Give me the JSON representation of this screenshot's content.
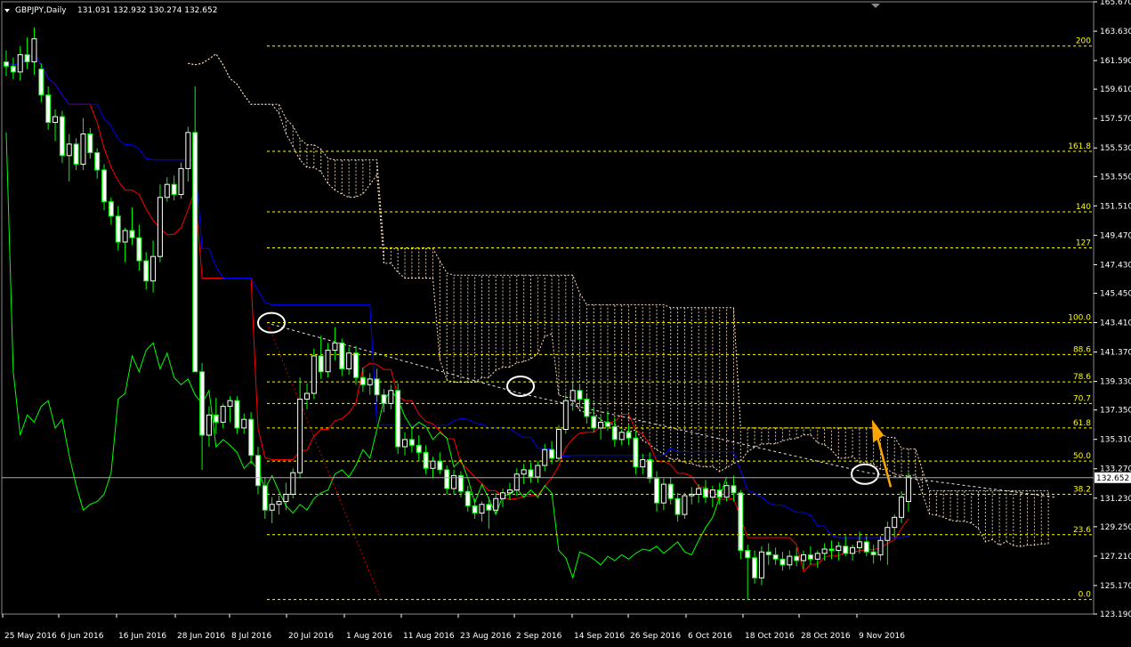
{
  "header": {
    "title": "GBPJPY,Daily",
    "ohlc": "131.031 132.932 130.274 132.652"
  },
  "colors": {
    "background": "#000000",
    "bull_candle": "#ffffff",
    "bear_candle": "#ffffff",
    "wick": "#00ff00",
    "tenkan": "#ff0000",
    "kijun": "#0000ff",
    "chikou": "#00ff00",
    "fib": "#ffff00",
    "kumo": "#ffe0c0",
    "arrow": "#ffa500",
    "price_line": "#aaaaaa"
  },
  "chart_data": {
    "type": "candlestick",
    "symbol": "GBPJPY",
    "timeframe": "Daily",
    "ylim": [
      123.19,
      165.67
    ],
    "y_ticks": [
      "165.670",
      "163.630",
      "161.590",
      "159.610",
      "157.570",
      "155.530",
      "153.550",
      "151.510",
      "149.470",
      "147.430",
      "145.450",
      "143.410",
      "141.370",
      "139.330",
      "137.350",
      "135.310",
      "133.270",
      "131.230",
      "129.250",
      "127.210",
      "125.170",
      "123.190"
    ],
    "x_ticks": [
      "25 May 2016",
      "6 Jun 2016",
      "16 Jun 2016",
      "28 Jun 2016",
      "8 Jul 2016",
      "20 Jul 2016",
      "1 Aug 2016",
      "11 Aug 2016",
      "23 Aug 2016",
      "2 Sep 2016",
      "14 Sep 2016",
      "26 Sep 2016",
      "6 Oct 2016",
      "18 Oct 2016",
      "28 Oct 2016",
      "9 Nov 2016"
    ],
    "current_price": "132.652",
    "fibonacci": {
      "high": 143.41,
      "low": 124.2,
      "levels": [
        {
          "label": "200",
          "value": 162.6
        },
        {
          "label": "161.8",
          "value": 155.3
        },
        {
          "label": "140",
          "value": 151.1
        },
        {
          "label": "127",
          "value": 148.6
        },
        {
          "label": "100.0",
          "value": 143.41
        },
        {
          "label": "88.6",
          "value": 141.2
        },
        {
          "label": "78.6",
          "value": 139.3
        },
        {
          "label": "70.7",
          "value": 137.8
        },
        {
          "label": "61.8",
          "value": 136.1
        },
        {
          "label": "50.0",
          "value": 133.8
        },
        {
          "label": "38.2",
          "value": 131.5
        },
        {
          "label": "23.6",
          "value": 128.7
        },
        {
          "label": "0.0",
          "value": 124.2
        }
      ]
    },
    "candles": [
      [
        161.5,
        162.3,
        160.5,
        161.2
      ],
      [
        161.2,
        161.8,
        160.3,
        160.8
      ],
      [
        160.8,
        162.6,
        160.2,
        162.0
      ],
      [
        162.0,
        163.2,
        161.0,
        161.5
      ],
      [
        161.5,
        163.9,
        160.6,
        163.1
      ],
      [
        161.0,
        161.4,
        158.7,
        159.2
      ],
      [
        159.2,
        159.8,
        156.8,
        157.3
      ],
      [
        157.3,
        158.2,
        156.0,
        157.7
      ],
      [
        157.7,
        158.1,
        154.5,
        155.0
      ],
      [
        155.0,
        156.5,
        153.2,
        155.8
      ],
      [
        155.8,
        156.2,
        154.0,
        154.4
      ],
      [
        154.4,
        157.6,
        154.0,
        156.5
      ],
      [
        156.5,
        156.9,
        154.8,
        155.2
      ],
      [
        155.2,
        155.5,
        153.4,
        154.0
      ],
      [
        154.0,
        154.4,
        151.2,
        151.8
      ],
      [
        151.8,
        152.1,
        150.2,
        150.8
      ],
      [
        150.8,
        151.5,
        148.4,
        149.0
      ],
      [
        149.0,
        150.0,
        147.6,
        149.8
      ],
      [
        149.8,
        151.4,
        148.8,
        149.3
      ],
      [
        149.3,
        150.2,
        147.0,
        147.7
      ],
      [
        147.7,
        148.3,
        145.7,
        146.3
      ],
      [
        146.3,
        149.1,
        145.5,
        148.0
      ],
      [
        148.0,
        153.0,
        147.6,
        152.1
      ],
      [
        152.1,
        153.5,
        151.8,
        153.0
      ],
      [
        153.0,
        153.6,
        151.9,
        152.3
      ],
      [
        152.3,
        154.5,
        152.0,
        154.1
      ],
      [
        154.1,
        157.0,
        153.2,
        156.6
      ],
      [
        156.6,
        159.8,
        154.2,
        140.0
      ],
      [
        140.0,
        140.6,
        133.2,
        135.6
      ],
      [
        135.6,
        137.6,
        134.8,
        137.0
      ],
      [
        137.0,
        138.2,
        135.7,
        136.5
      ],
      [
        136.5,
        137.8,
        136.1,
        137.6
      ],
      [
        137.6,
        138.3,
        136.5,
        138.0
      ],
      [
        138.0,
        138.3,
        135.7,
        136.1
      ],
      [
        136.1,
        137.1,
        135.7,
        136.7
      ],
      [
        136.7,
        137.2,
        133.6,
        134.2
      ],
      [
        134.2,
        134.8,
        131.5,
        132.1
      ],
      [
        132.1,
        132.7,
        129.8,
        130.4
      ],
      [
        130.4,
        131.3,
        129.5,
        130.8
      ],
      [
        130.8,
        131.4,
        130.1,
        131.0
      ],
      [
        131.0,
        132.3,
        130.4,
        131.5
      ],
      [
        131.5,
        133.3,
        131.2,
        133.0
      ],
      [
        133.0,
        139.6,
        132.6,
        138.1
      ],
      [
        138.1,
        139.2,
        137.4,
        138.5
      ],
      [
        138.5,
        141.6,
        138.1,
        141.1
      ],
      [
        141.1,
        142.5,
        139.5,
        140.0
      ],
      [
        140.0,
        142.0,
        139.6,
        141.5
      ],
      [
        141.5,
        143.1,
        140.8,
        142.0
      ],
      [
        142.0,
        142.3,
        139.7,
        140.2
      ],
      [
        140.2,
        141.7,
        139.8,
        141.3
      ],
      [
        141.3,
        141.8,
        139.1,
        139.6
      ],
      [
        139.6,
        140.3,
        138.6,
        139.1
      ],
      [
        139.1,
        139.9,
        138.4,
        139.5
      ],
      [
        139.5,
        140.2,
        137.9,
        138.4
      ],
      [
        138.4,
        138.8,
        137.2,
        137.8
      ],
      [
        137.8,
        139.1,
        137.4,
        138.7
      ],
      [
        138.7,
        139.2,
        134.3,
        134.8
      ],
      [
        134.8,
        135.8,
        134.2,
        135.3
      ],
      [
        135.3,
        136.1,
        134.4,
        134.9
      ],
      [
        134.9,
        135.6,
        133.8,
        134.4
      ],
      [
        134.4,
        134.9,
        132.9,
        133.3
      ],
      [
        133.3,
        134.1,
        132.6,
        133.8
      ],
      [
        133.8,
        134.4,
        132.9,
        133.2
      ],
      [
        133.2,
        133.5,
        131.5,
        131.9
      ],
      [
        131.9,
        133.2,
        131.5,
        132.8
      ],
      [
        132.8,
        133.1,
        131.3,
        131.7
      ],
      [
        131.7,
        132.1,
        130.3,
        130.7
      ],
      [
        130.7,
        131.2,
        129.8,
        130.2
      ],
      [
        130.2,
        131.0,
        129.6,
        130.8
      ],
      [
        130.8,
        131.3,
        129.1,
        130.4
      ],
      [
        130.4,
        131.6,
        130.1,
        131.2
      ],
      [
        131.2,
        131.9,
        130.6,
        131.6
      ],
      [
        131.6,
        132.3,
        131.1,
        131.8
      ],
      [
        131.8,
        133.3,
        131.4,
        132.9
      ],
      [
        132.9,
        133.6,
        132.2,
        133.2
      ],
      [
        133.2,
        133.7,
        132.3,
        132.7
      ],
      [
        132.7,
        133.8,
        132.3,
        133.5
      ],
      [
        133.5,
        135.0,
        133.1,
        134.6
      ],
      [
        134.6,
        135.2,
        133.6,
        134.0
      ],
      [
        134.0,
        136.3,
        133.8,
        136.0
      ],
      [
        136.0,
        138.4,
        135.7,
        138.0
      ],
      [
        138.0,
        139.3,
        137.3,
        138.7
      ],
      [
        138.7,
        139.0,
        137.6,
        138.1
      ],
      [
        138.1,
        138.4,
        136.4,
        136.9
      ],
      [
        136.9,
        137.6,
        135.8,
        136.1
      ],
      [
        136.1,
        136.9,
        135.3,
        136.5
      ],
      [
        136.5,
        137.3,
        135.9,
        136.2
      ],
      [
        136.2,
        136.8,
        134.8,
        135.3
      ],
      [
        135.3,
        136.0,
        134.9,
        135.8
      ],
      [
        135.8,
        136.3,
        134.9,
        135.4
      ],
      [
        135.4,
        135.9,
        132.9,
        133.4
      ],
      [
        133.4,
        134.3,
        132.9,
        133.9
      ],
      [
        133.9,
        134.4,
        132.3,
        132.6
      ],
      [
        132.6,
        133.1,
        130.3,
        130.9
      ],
      [
        130.9,
        132.6,
        130.4,
        132.2
      ],
      [
        132.2,
        132.7,
        130.8,
        131.2
      ],
      [
        131.2,
        131.6,
        129.6,
        130.1
      ],
      [
        130.1,
        131.6,
        129.8,
        131.4
      ],
      [
        131.4,
        132.0,
        130.8,
        131.5
      ],
      [
        131.5,
        132.2,
        130.9,
        131.9
      ],
      [
        131.9,
        132.5,
        130.9,
        131.3
      ],
      [
        131.3,
        132.1,
        130.6,
        131.8
      ],
      [
        131.8,
        132.3,
        130.8,
        131.3
      ],
      [
        131.3,
        132.4,
        131.0,
        132.1
      ],
      [
        132.1,
        132.8,
        131.0,
        131.6
      ],
      [
        131.6,
        131.8,
        127.0,
        127.6
      ],
      [
        127.6,
        128.0,
        124.2,
        127.1
      ],
      [
        127.1,
        127.6,
        125.3,
        125.7
      ],
      [
        125.7,
        127.9,
        125.2,
        127.5
      ],
      [
        127.5,
        128.1,
        126.6,
        127.3
      ],
      [
        127.3,
        127.8,
        126.6,
        127.0
      ],
      [
        127.0,
        127.5,
        126.2,
        126.6
      ],
      [
        126.6,
        127.6,
        126.3,
        127.2
      ],
      [
        127.2,
        127.8,
        126.5,
        126.9
      ],
      [
        126.9,
        127.6,
        126.3,
        127.3
      ],
      [
        127.3,
        127.9,
        126.6,
        127.0
      ],
      [
        127.0,
        127.6,
        126.4,
        127.4
      ],
      [
        127.4,
        128.1,
        126.9,
        127.7
      ],
      [
        127.7,
        128.3,
        127.0,
        127.6
      ],
      [
        127.6,
        128.2,
        126.9,
        127.9
      ],
      [
        127.9,
        128.6,
        127.2,
        127.4
      ],
      [
        127.4,
        128.0,
        126.9,
        127.8
      ],
      [
        127.8,
        128.9,
        127.4,
        128.2
      ],
      [
        128.2,
        128.6,
        127.2,
        127.5
      ],
      [
        127.5,
        128.0,
        126.7,
        127.3
      ],
      [
        127.3,
        128.6,
        126.9,
        128.3
      ],
      [
        128.3,
        129.6,
        126.6,
        129.2
      ],
      [
        129.2,
        130.1,
        128.5,
        129.9
      ],
      [
        129.9,
        131.7,
        129.5,
        131.3
      ],
      [
        131.0,
        133.0,
        130.3,
        132.7
      ]
    ]
  }
}
